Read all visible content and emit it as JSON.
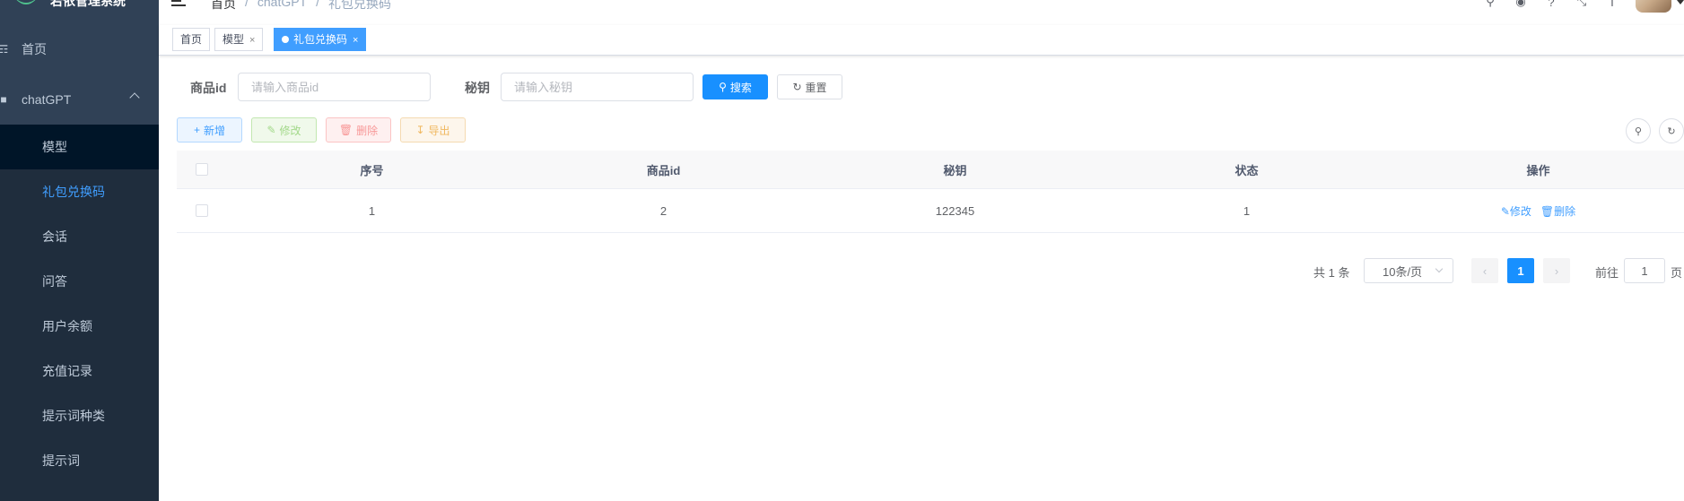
{
  "app": {
    "title": "若依管理系统"
  },
  "sidebar": {
    "items": [
      {
        "label": "首页",
        "icon": "dashboard-icon"
      },
      {
        "label": "chatGPT",
        "icon": "message-icon"
      }
    ],
    "submenu": [
      {
        "label": "模型"
      },
      {
        "label": "礼包兑换码"
      },
      {
        "label": "会话"
      },
      {
        "label": "问答"
      },
      {
        "label": "用户余额"
      },
      {
        "label": "充值记录"
      },
      {
        "label": "提示词种类"
      },
      {
        "label": "提示词"
      }
    ],
    "active_color": "#409eff",
    "background": "#304156"
  },
  "breadcrumb": [
    "首页",
    "chatGPT",
    "礼包兑换码"
  ],
  "tags": [
    {
      "label": "首页",
      "closable": false
    },
    {
      "label": "模型",
      "closable": true
    },
    {
      "label": "礼包兑换码",
      "closable": true,
      "active": true
    }
  ],
  "search": {
    "product_label": "商品id",
    "product_placeholder": "请输入商品id",
    "secret_label": "秘钥",
    "secret_placeholder": "请输入秘钥",
    "search_button": "搜索",
    "reset_button": "重置"
  },
  "toolbar": {
    "add": "新增",
    "edit": "修改",
    "delete": "删除",
    "export": "导出"
  },
  "table": {
    "headers": [
      "序号",
      "商品id",
      "秘钥",
      "状态",
      "操作"
    ],
    "rows": [
      {
        "index": "1",
        "product_id": "2",
        "secret": "122345",
        "status": "1",
        "edit": "修改",
        "delete": "删除"
      }
    ]
  },
  "pagination": {
    "total_text": "共 1 条",
    "page_size": "10条/页",
    "current_page": "1",
    "goto_label": "前往",
    "goto_value": "1",
    "page_suffix": "页"
  }
}
